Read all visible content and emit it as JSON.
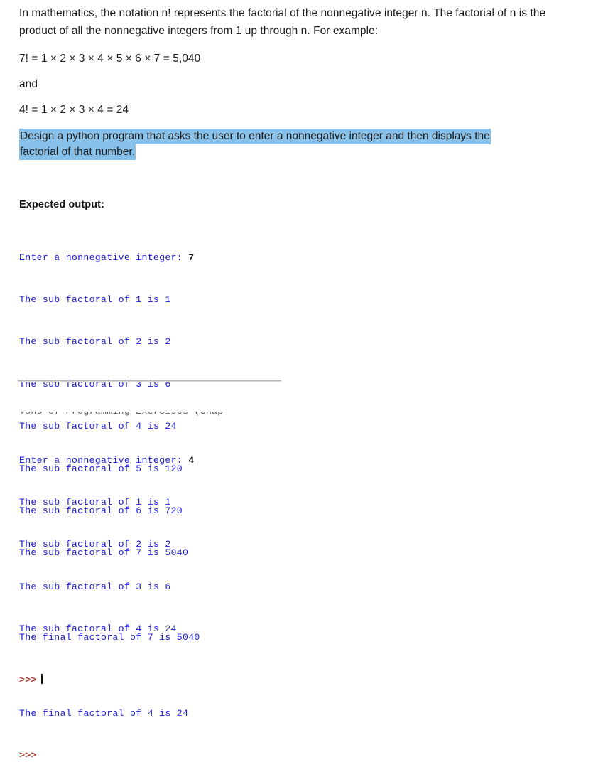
{
  "document": {
    "intro_paragraph": "In mathematics, the notation n! represents the factorial of the nonnegative integer n. The factorial of n is the product of all the nonnegative integers from 1 up through n. For example:",
    "example_7": "7! = 1 × 2 × 3 × 4 × 5 × 6 × 7 = 5,040",
    "conjunction": "and",
    "example_4": "4! = 1 × 2 × 3 × 4 = 24",
    "assignment_line1": "Design a python program that asks the user to enter a nonnegative integer and then displays the",
    "assignment_line2": "factorial of that number.",
    "expected_output_heading": "Expected output:",
    "highlight_color": "#87c0e8"
  },
  "console_one": {
    "prompt_line": "Enter a nonnegative integer: ",
    "user_input": "7",
    "sub_lines": [
      "The sub factoral of 1 is 1",
      "The sub factoral of 2 is 2",
      "The sub factoral of 3 is 6",
      "The sub factoral of 4 is 24",
      "The sub factoral of 5 is 120",
      "The sub factoral of 6 is 720",
      "The sub factoral of 7 is 5040"
    ],
    "final_line": "The final factoral of 7 is 5040",
    "shell_prompt": ">>>",
    "text_color": "#1a1ad2",
    "prompt_color": "#a03a28"
  },
  "console_two": {
    "clipped_scrollback": "Tons of Programming Exercises (Chap",
    "prompt_line": "Enter a nonnegative integer: ",
    "user_input": "4",
    "sub_lines": [
      "The sub factoral of 1 is 1",
      "The sub factoral of 2 is 2",
      "The sub factoral of 3 is 6",
      "The sub factoral of 4 is 24"
    ],
    "final_line": "The final factoral of 4 is 24",
    "shell_prompt": ">>>"
  }
}
